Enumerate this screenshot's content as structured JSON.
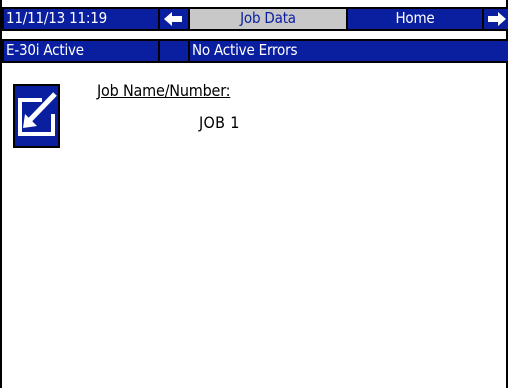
{
  "status_bar": {
    "datetime": "11/11/13 11:19",
    "screen_title": "Job Data",
    "home_label": "Home",
    "machine_status": "E-30i Active",
    "error_status": "No Active Errors"
  },
  "icons": {
    "prev": "arrow-left-icon",
    "next": "arrow-right-icon",
    "edit": "edit-icon"
  },
  "job": {
    "label": "Job Name/Number:",
    "value": "JOB 1"
  },
  "colors": {
    "bar": "#0a1ea0",
    "tab_inactive": "#c8c8c8",
    "text_dark": "#000000",
    "text_light": "#ffffff"
  }
}
